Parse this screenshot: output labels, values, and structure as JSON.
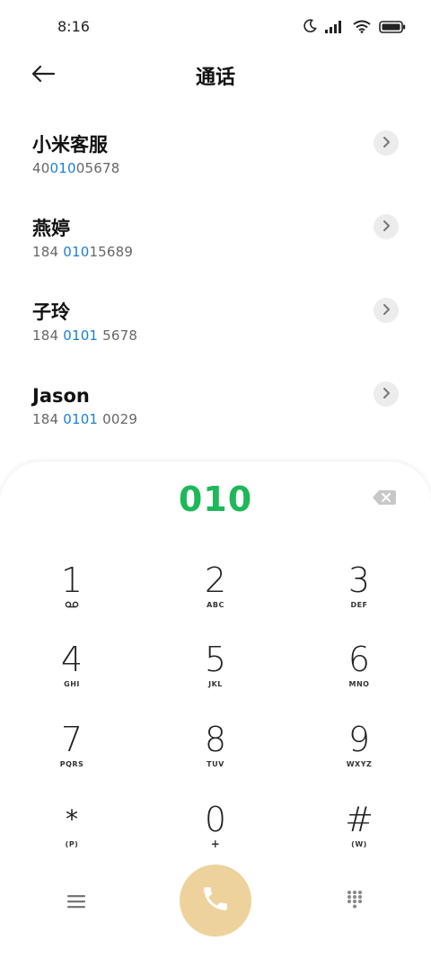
{
  "status_bar": {
    "time": "8:16",
    "icons": [
      "moon-icon",
      "signal-icon",
      "wifi-icon",
      "battery-icon"
    ]
  },
  "header": {
    "title": "通话",
    "back_icon": "back-arrow-icon"
  },
  "contacts": [
    {
      "name": "小米客服",
      "number_pre": "40",
      "number_match": "010",
      "number_post": "05678"
    },
    {
      "name": "燕婷",
      "number_pre": "184 ",
      "number_match": "010",
      "number_post": "15689"
    },
    {
      "name": "子玲",
      "number_pre": "184 ",
      "number_match": "0101",
      "number_post": " 5678"
    },
    {
      "name": "Jason",
      "number_pre": "184 ",
      "number_match": "0101",
      "number_post": " 0029"
    }
  ],
  "dialpad": {
    "entered": "010",
    "keys": [
      {
        "digit": "1",
        "sub": ""
      },
      {
        "digit": "2",
        "sub": "ABC"
      },
      {
        "digit": "3",
        "sub": "DEF"
      },
      {
        "digit": "4",
        "sub": "GHI"
      },
      {
        "digit": "5",
        "sub": "JKL"
      },
      {
        "digit": "6",
        "sub": "MNO"
      },
      {
        "digit": "7",
        "sub": "PQRS"
      },
      {
        "digit": "8",
        "sub": "TUV"
      },
      {
        "digit": "9",
        "sub": "WXYZ"
      },
      {
        "digit": "*",
        "sub": "(P)"
      },
      {
        "digit": "0",
        "sub": "+"
      },
      {
        "digit": "#",
        "sub": "(W)"
      }
    ]
  },
  "colors": {
    "match_highlight": "#1a7fd8",
    "entered_number": "#1eb85a",
    "call_button": "#eed29c"
  }
}
